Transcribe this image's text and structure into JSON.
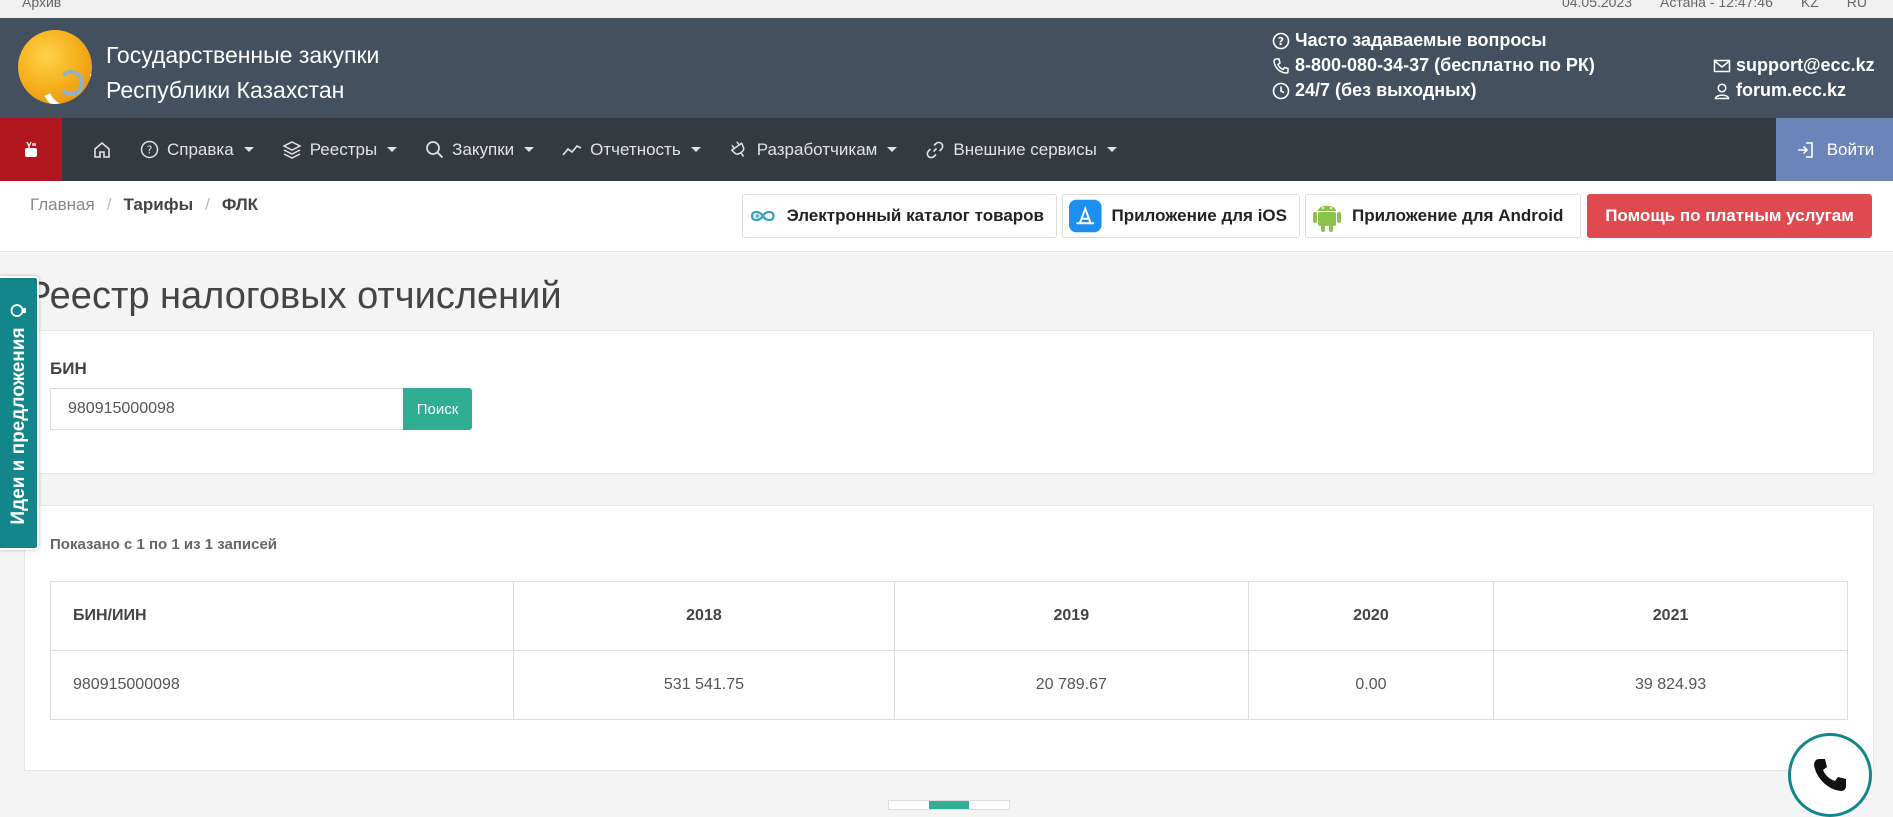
{
  "topline": {
    "archive": "Архив",
    "date": "04.05.2023",
    "clock": "Астана - 12:47:46",
    "lang_kz": "KZ",
    "lang_ru": "RU"
  },
  "header": {
    "brand_line1": "Государственные закупки",
    "brand_line2": "Республики Казахстан",
    "faq": "Часто задаваемые вопросы",
    "phone": "8-800-080-34-37 (бесплатно по РК)",
    "hours": "24/7 (без выходных)",
    "email": "support@ecc.kz",
    "forum": "forum.ecc.kz"
  },
  "nav": {
    "items": [
      "Справка",
      "Реестры",
      "Закупки",
      "Отчетность",
      "Разработчикам",
      "Внешние сервисы"
    ],
    "login": "Войти"
  },
  "breadcrumb": [
    "Главная",
    "Тарифы",
    "ФЛК"
  ],
  "quick_links": {
    "catalog": "Электронный каталог товаров",
    "ios": "Приложение для iOS",
    "android": "Приложение для Android",
    "help": "Помощь по платным услугам"
  },
  "side_tab": "Идеи и предложения",
  "page_title": "Реестр налоговых отчислений",
  "search": {
    "label": "БИН",
    "value": "980915000098",
    "button": "Поиск"
  },
  "results": {
    "summary": "Показано с 1 по 1 из 1 записей",
    "columns": [
      "БИН/ИИН",
      "2018",
      "2019",
      "2020",
      "2021"
    ],
    "rows": [
      [
        "980915000098",
        "531 541.75",
        "20 789.67",
        "0.00",
        "39 824.93"
      ]
    ]
  },
  "colors": {
    "header_bg": "#42505f",
    "navbar_bg": "#343a40",
    "youtube_red": "#b1151d",
    "login_blue": "#6c84b9",
    "help_red": "#e04a4f",
    "search_green": "#2fae93",
    "teal": "#13868c"
  }
}
